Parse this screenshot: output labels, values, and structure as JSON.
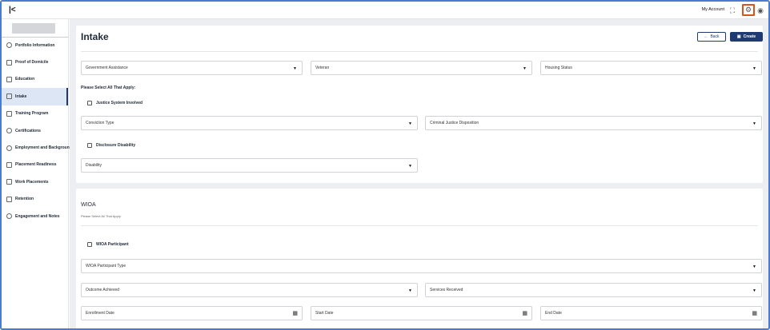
{
  "topbar": {
    "collapse_icon": "collapse-icon",
    "my_account_label": "My Account",
    "icons": [
      "fullscreen-icon",
      "gear-icon",
      "user-icon"
    ]
  },
  "sidebar": {
    "items": [
      {
        "label": "Portfolio Information",
        "icon": "portfolio-icon"
      },
      {
        "label": "Proof of Domicile",
        "icon": "folder-icon"
      },
      {
        "label": "Education",
        "icon": "graduation-cap-icon"
      },
      {
        "label": "Intake",
        "icon": "folder-icon",
        "active": true
      },
      {
        "label": "Training Program",
        "icon": "training-icon"
      },
      {
        "label": "Certifications",
        "icon": "certificate-icon"
      },
      {
        "label": "Employment and Background",
        "icon": "employment-icon"
      },
      {
        "label": "Placement Readiness",
        "icon": "readiness-icon"
      },
      {
        "label": "Work Placements",
        "icon": "briefcase-icon"
      },
      {
        "label": "Retention",
        "icon": "retention-icon"
      },
      {
        "label": "Engagement and Notes",
        "icon": "notes-icon"
      }
    ]
  },
  "intake": {
    "title": "Intake",
    "back_label": "Back",
    "create_label": "Create",
    "government_assistance": "Government Assistance",
    "veteran": "Veteran",
    "housing_status": "Housing Status",
    "select_all_label": "Please Select All That Apply:",
    "justice_involved_label": "Justice System Involved",
    "conviction_type": "Conviction Type",
    "criminal_disposition": "Criminal Justice Disposition",
    "disclosure_disability_label": "Disclosure Disability",
    "disability": "Disability"
  },
  "wioa": {
    "title": "WIOA",
    "subtitle": "Please Select All That Apply",
    "participant_label": "WIOA Participant",
    "participant_type": "WIOA Participant Type",
    "outcome_achieved": "Outcome Achieved",
    "services_received": "Services Received",
    "enrollment_date": "Enrollment Date",
    "start_date": "Start Date",
    "end_date": "End Date"
  },
  "colors": {
    "accent": "#1e3a70",
    "active_bg": "#dde6f5",
    "highlight": "#d9531e",
    "frame": "#4a7bd0"
  }
}
